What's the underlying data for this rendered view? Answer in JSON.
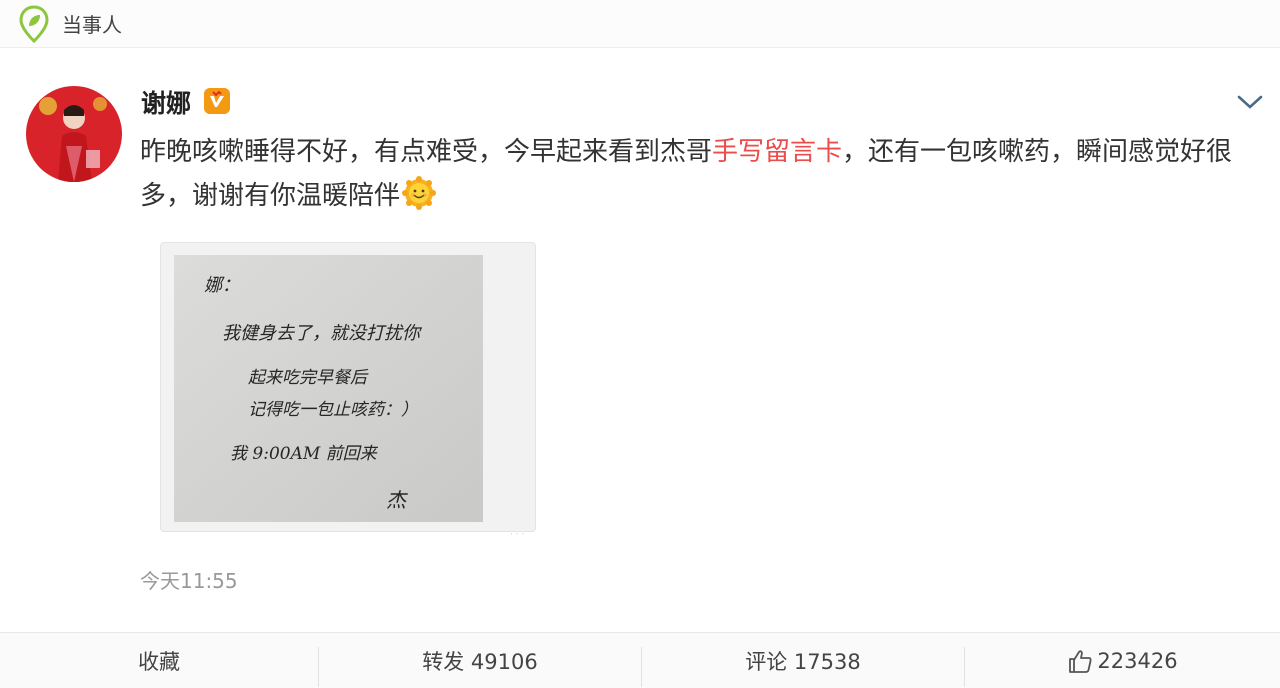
{
  "topbar": {
    "source_label": "当事人"
  },
  "post": {
    "username": "谢娜",
    "text_before": "昨晚咳嗽睡得不好，有点难受，今早起来看到杰哥",
    "link_text": "手写留言卡",
    "text_after": "，还有一包咳嗽药，瞬间感觉好很多，谢谢有你温暖陪伴",
    "emoji": "sun-smile-emoji",
    "time": "今天11:55"
  },
  "note": {
    "greeting": "娜：",
    "line1": "我健身去了，就没打扰你",
    "line2": "起来吃完早餐后",
    "line3": "记得吃一包止咳药：）",
    "line4": "我 9:00AM 前回来",
    "signature": "杰"
  },
  "actions": {
    "favorite": "收藏",
    "repost": "转发 49106",
    "comment": "评论 17538",
    "like_count": "223426"
  },
  "colors": {
    "link": "#eb4c4c",
    "badge": "#f39a12",
    "pin_green": "#8cc63f"
  },
  "icons": {
    "pin": "location-pin-icon",
    "verified": "verified-badge-icon",
    "expand": "chevron-down-icon",
    "like": "thumbs-up-icon"
  }
}
